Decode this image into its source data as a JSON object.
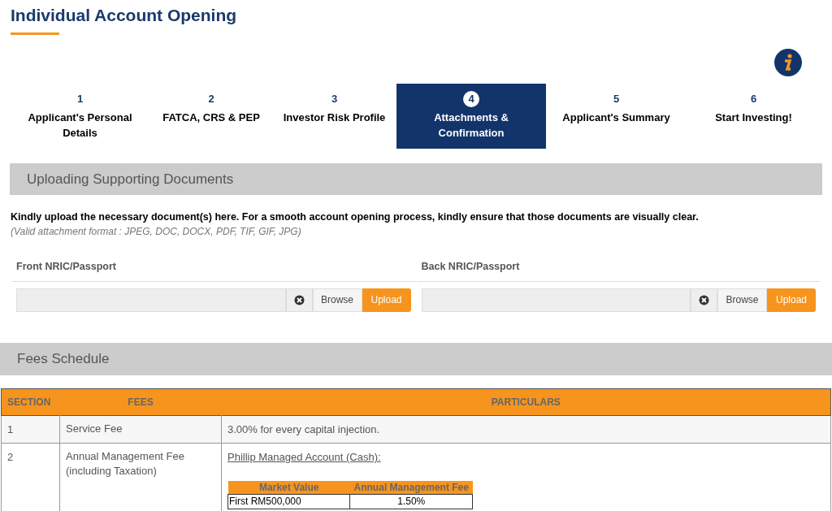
{
  "page_title": "Individual Account Opening",
  "steps": [
    {
      "number": "1",
      "label": "Applicant's Personal Details",
      "selected": false
    },
    {
      "number": "2",
      "label": "FATCA, CRS & PEP",
      "selected": false
    },
    {
      "number": "3",
      "label": "Investor Risk Profile",
      "selected": false
    },
    {
      "number": "4",
      "label": "Attachments & Confirmation",
      "selected": true
    },
    {
      "number": "5",
      "label": "Applicant's Summary",
      "selected": false
    },
    {
      "number": "6",
      "label": "Start Investing!",
      "selected": false
    }
  ],
  "upload_section": {
    "title": "Uploading Supporting Documents",
    "instruction": "Kindly upload the necessary document(s) here. For a smooth account opening process, kindly ensure that those documents are visually clear.",
    "formats_note": "(Valid attachment format : JPEG, DOC, DOCX, PDF, TIF, GIF, JPG)",
    "fields": [
      {
        "label": "Front NRIC/Passport",
        "browse": "Browse",
        "upload": "Upload"
      },
      {
        "label": "Back NRIC/Passport",
        "browse": "Browse",
        "upload": "Upload"
      }
    ]
  },
  "fees_section": {
    "title": "Fees Schedule",
    "table": {
      "columns": [
        "SECTION",
        "FEES",
        "PARTICULARS"
      ],
      "rows": [
        {
          "section": "1",
          "fee": "Service Fee",
          "particulars": "3.00% for every capital injection."
        },
        {
          "section": "2",
          "fee": "Annual Management Fee (including Taxation)",
          "particulars_link": "Phillip Managed Account (Cash):",
          "inner_table": {
            "columns": [
              "Market Value",
              "Annual Management Fee"
            ],
            "rows": [
              [
                "First RM500,000",
                "1.50%"
              ]
            ]
          }
        }
      ]
    }
  }
}
